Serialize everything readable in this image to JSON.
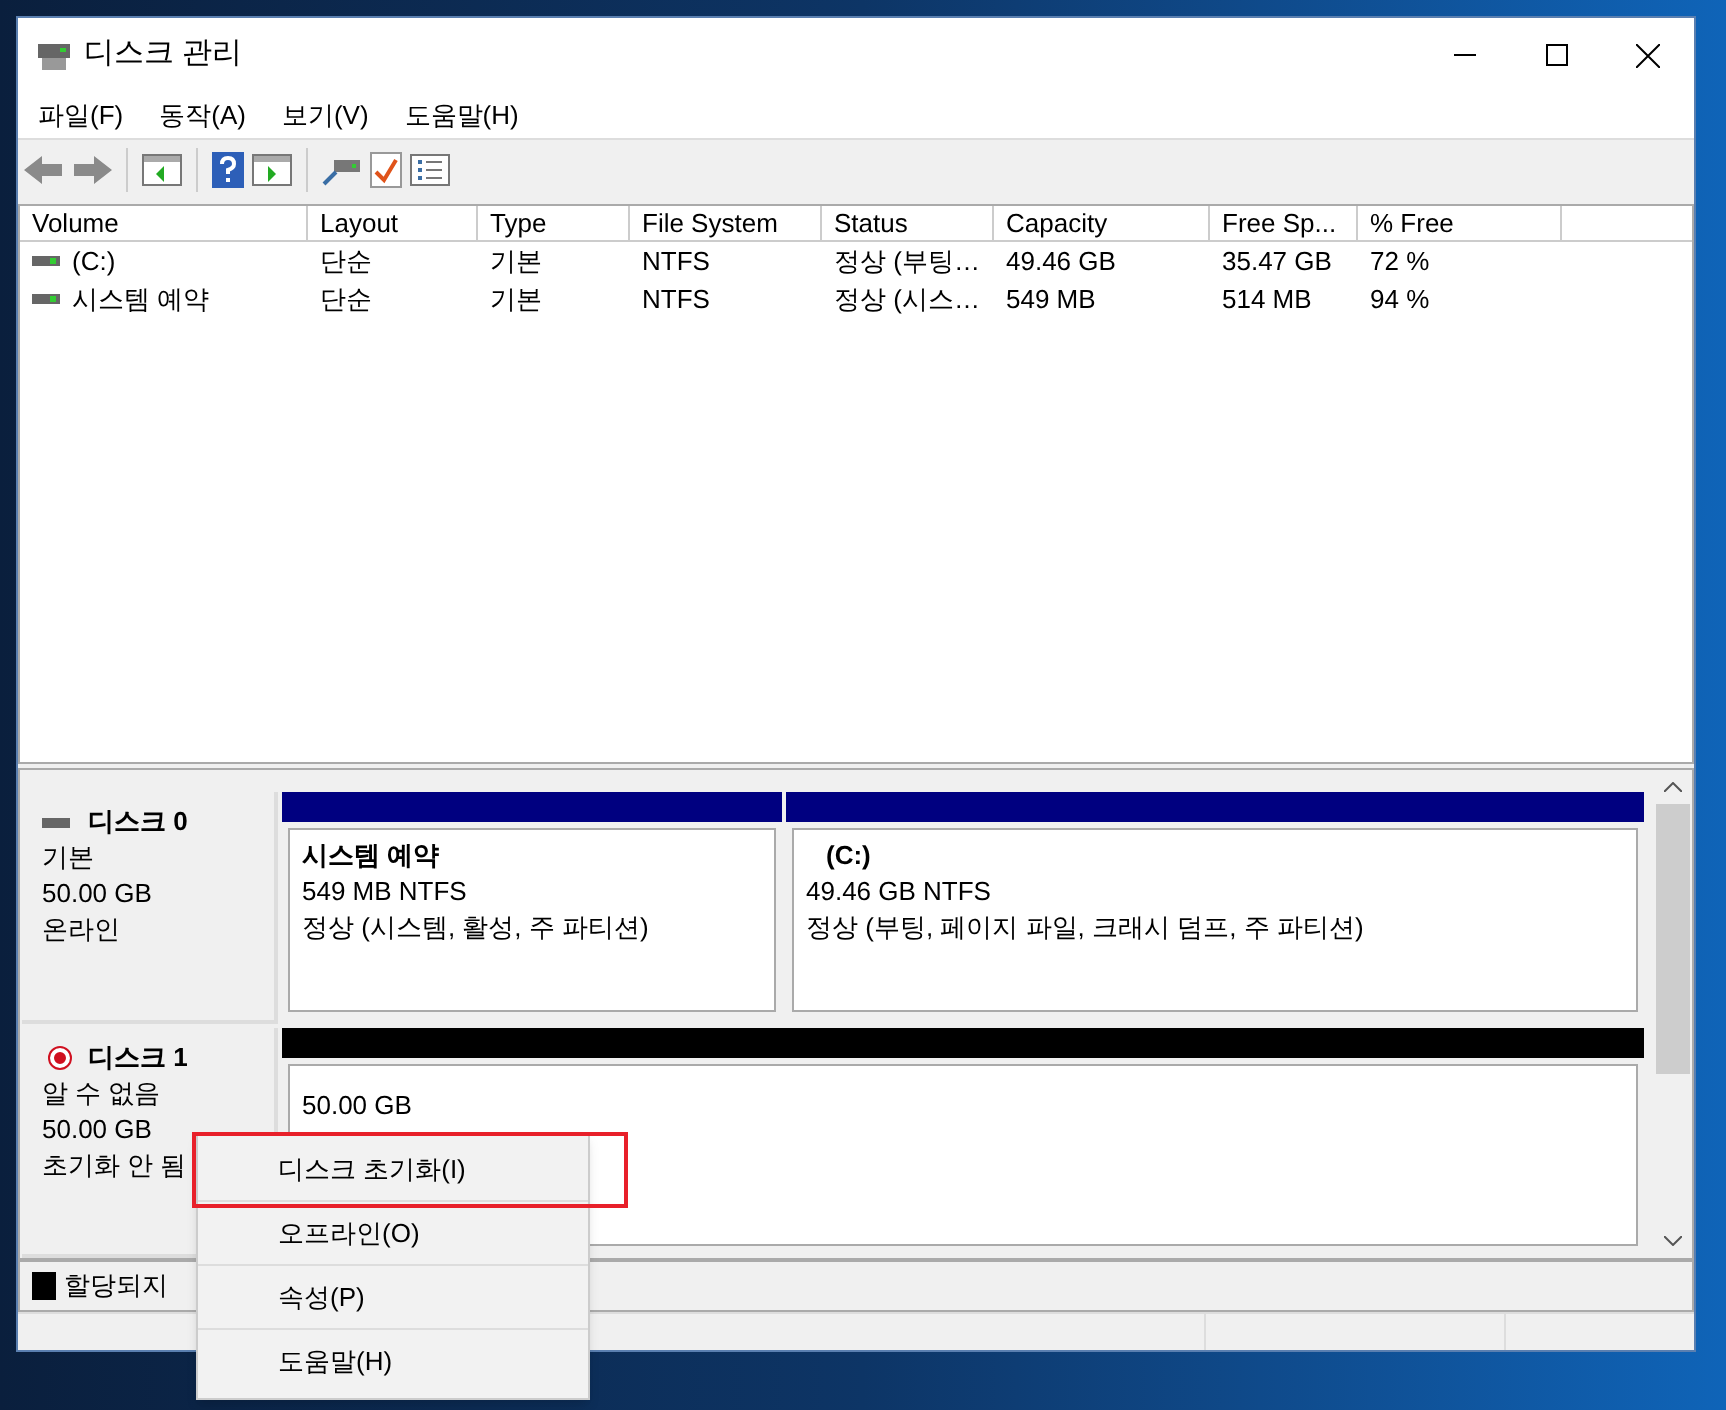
{
  "window": {
    "title": "디스크 관리"
  },
  "menu": [
    "파일(F)",
    "동작(A)",
    "보기(V)",
    "도움말(H)"
  ],
  "volumes": {
    "columns": [
      "Volume",
      "Layout",
      "Type",
      "File System",
      "Status",
      "Capacity",
      "Free Sp...",
      "% Free"
    ],
    "rows": [
      {
        "cells": [
          "(C:)",
          "단순",
          "기본",
          "NTFS",
          "정상 (부팅…",
          "49.46 GB",
          "35.47 GB",
          "72 %"
        ]
      },
      {
        "cells": [
          "시스템 예약",
          "단순",
          "기본",
          "NTFS",
          "정상 (시스…",
          "549 MB",
          "514 MB",
          "94 %"
        ]
      }
    ]
  },
  "disks": [
    {
      "name": "디스크 0",
      "kind": "basic",
      "lines": [
        "기본",
        "50.00 GB",
        "온라인"
      ],
      "partitions": [
        {
          "kind": "primary",
          "title": "시스템 예약",
          "lines": [
            "549 MB NTFS",
            "정상 (시스템, 활성, 주 파티션)"
          ]
        },
        {
          "kind": "primary",
          "title": "(C:)",
          "lines": [
            "49.46 GB NTFS",
            "정상 (부팅, 페이지 파일, 크래시 덤프, 주 파티션)"
          ]
        }
      ]
    },
    {
      "name": "디스크 1",
      "kind": "uninitialized",
      "lines": [
        "알 수 없음",
        "50.00 GB",
        "초기화 안 됨"
      ],
      "partitions": [
        {
          "kind": "unallocated",
          "lines": [
            "50.00 GB"
          ]
        }
      ]
    }
  ],
  "legend": [
    {
      "label": "할당되지",
      "color": "#000000"
    }
  ],
  "context_menu": {
    "items": [
      {
        "label": "디스크 초기화(I)",
        "annotated": true
      },
      {
        "label": "오프라인(O)",
        "annotated": false
      },
      {
        "label": "속성(P)",
        "annotated": false
      },
      {
        "label": "도움말(H)",
        "annotated": false
      }
    ]
  }
}
